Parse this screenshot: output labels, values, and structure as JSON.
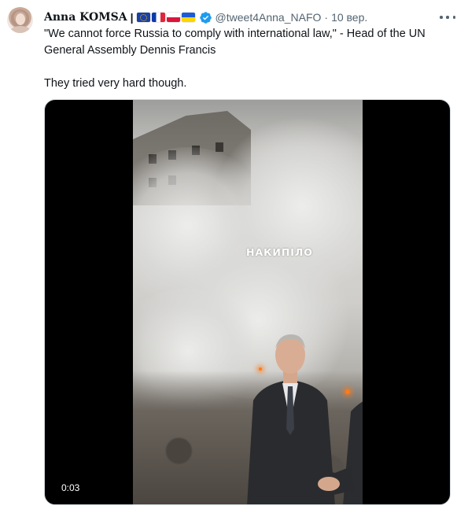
{
  "author": {
    "name": "Anna KOMSA",
    "separator": "|",
    "handle": "@tweet4Anna_NAFO",
    "dot": "·",
    "date": "10 вер.",
    "flags": [
      "flag-eu-icon",
      "flag-france-icon",
      "flag-poland-icon",
      "flag-ukraine-icon"
    ]
  },
  "tweet": {
    "paragraph1": "\"We cannot force Russia to comply with international law,\" - Head of the UN General Assembly Dennis Francis",
    "paragraph2": "They tried very hard though."
  },
  "media": {
    "watermark": "НАКИПІЛО",
    "timestamp": "0:03"
  },
  "colors": {
    "text": "#0f1419",
    "secondary": "#536471",
    "verified": "#1d9bf0",
    "media_background": "#000000"
  }
}
